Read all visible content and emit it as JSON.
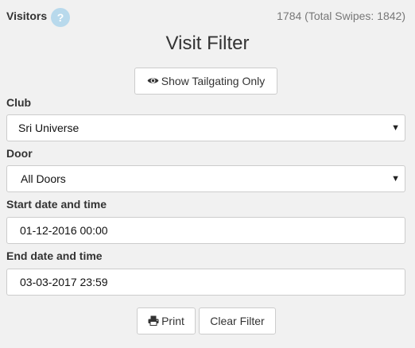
{
  "header": {
    "title": "Visitors",
    "help_icon_glyph": "?",
    "stats": "1784 (Total Swipes: 1842)"
  },
  "page_title": "Visit Filter",
  "tailgating_button": {
    "label": "Show Tailgating Only",
    "icon": "eye-icon"
  },
  "fields": {
    "club": {
      "label": "Club",
      "selected": "Sri Universe"
    },
    "door": {
      "label": "Door",
      "selected": "All Doors"
    },
    "start": {
      "label": "Start date and time",
      "value": "01-12-2016 00:00"
    },
    "end": {
      "label": "End date and time",
      "value": "03-03-2017 23:59"
    }
  },
  "footer": {
    "print_label": "Print",
    "print_icon": "print-icon",
    "clear_label": "Clear Filter"
  },
  "colors": {
    "background": "#f1f1f1",
    "help_icon": "#b8d9ec",
    "border": "#cccccc",
    "muted_text": "#777777"
  }
}
